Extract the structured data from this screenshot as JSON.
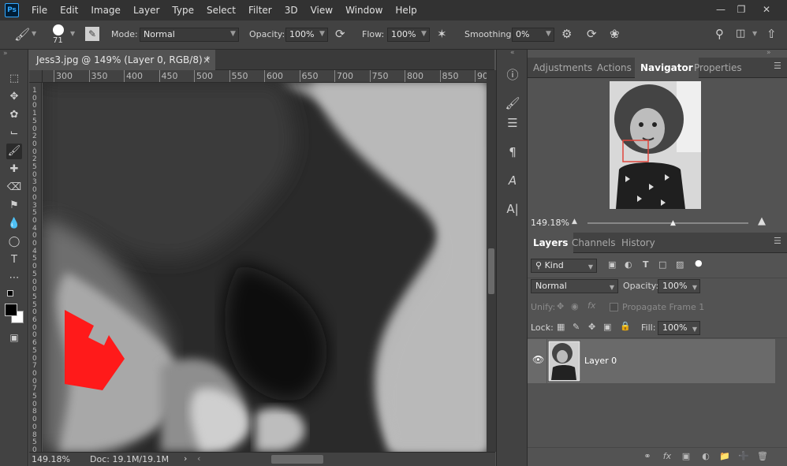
{
  "app": {
    "logo": "Ps"
  },
  "menu": [
    "File",
    "Edit",
    "Image",
    "Layer",
    "Type",
    "Select",
    "Filter",
    "3D",
    "View",
    "Window",
    "Help"
  ],
  "options": {
    "brush_size": "71",
    "mode_label": "Mode:",
    "mode_value": "Normal",
    "opacity_label": "Opacity:",
    "opacity_value": "100%",
    "flow_label": "Flow:",
    "flow_value": "100%",
    "smoothing_label": "Smoothing:",
    "smoothing_value": "0%"
  },
  "document": {
    "tab_title": "Jess3.jpg @ 149% (Layer 0, RGB/8) *",
    "close": "×",
    "ruler_h": [
      "300",
      "350",
      "400",
      "450",
      "500",
      "550",
      "600",
      "650",
      "700",
      "750",
      "800",
      "850",
      "90"
    ],
    "ruler_v": [
      "1",
      "0",
      "0",
      "1",
      "5",
      "0",
      "2",
      "0",
      "0",
      "2",
      "5",
      "0",
      "3",
      "0",
      "0",
      "3",
      "5",
      "0",
      "4",
      "0",
      "0",
      "4",
      "5",
      "0",
      "5",
      "0",
      "0",
      "5",
      "5",
      "0",
      "6",
      "0",
      "0",
      "6",
      "5",
      "0",
      "7",
      "0",
      "0",
      "7",
      "5",
      "0",
      "8",
      "0",
      "0",
      "8",
      "5",
      "0"
    ],
    "zoom": "149.18%",
    "doc_info": "Doc: 19.1M/19.1M",
    "status_arrow": "›",
    "status_left": "‹"
  },
  "navigator": {
    "tabs": [
      "Adjustments",
      "Actions",
      "Navigator",
      "Properties"
    ],
    "active_tab": "Navigator",
    "zoom": "149.18%",
    "colors": {
      "view_box": "#e0463c"
    }
  },
  "layers": {
    "tabs": [
      "Layers",
      "Channels",
      "History"
    ],
    "active_tab": "Layers",
    "kind_label": "Kind",
    "blend_mode": "Normal",
    "opacity_label": "Opacity:",
    "opacity_value": "100%",
    "unify_label": "Unify:",
    "propagate_label": "Propagate Frame 1",
    "lock_label": "Lock:",
    "fill_label": "Fill:",
    "fill_value": "100%",
    "items": [
      {
        "name": "Layer 0",
        "visible": true
      }
    ]
  },
  "colors": {
    "accent": "#31a8ff",
    "arrow_red": "#ff1a1a"
  }
}
